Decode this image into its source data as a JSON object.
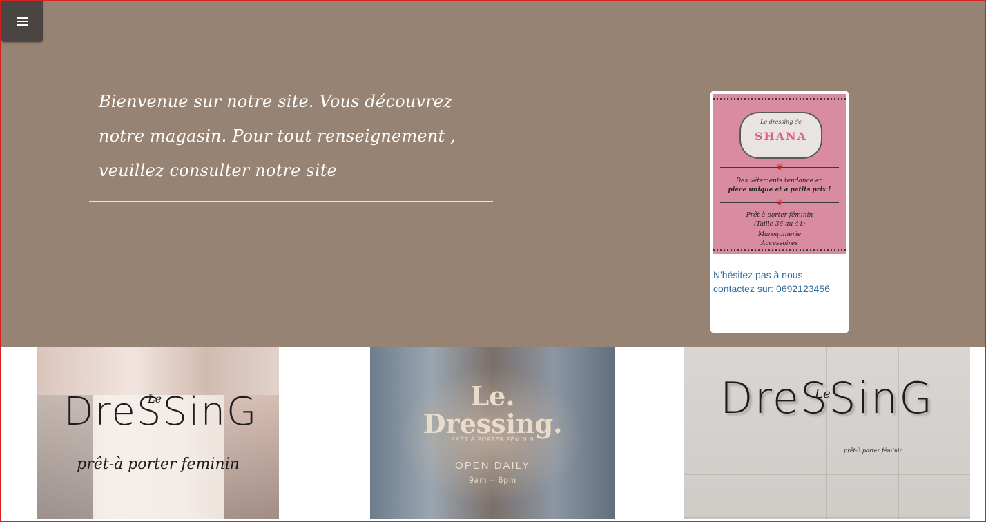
{
  "header": {
    "menu_icon": "hamburger-menu-icon"
  },
  "hero": {
    "welcome_text": "Bienvenue sur notre site. Vous découvrez notre magasin. Pour tout renseignement , veuillez consulter notre site"
  },
  "sidebar_card": {
    "poster": {
      "logo_small": "Le dressing de",
      "logo_big": "SHANA",
      "line1": "Des vêtements tendance en",
      "line2": "pièce unique et à petits prix !",
      "line3": "Prêt à porter féminin",
      "line4": "(Taille 36 au 44)",
      "line5": "Maroquinerie",
      "line6": "Accessoires"
    },
    "contact_text": "N'hésitez pas à nous contactez sur: 0692123456"
  },
  "gallery": {
    "image1": {
      "le": "Le",
      "logo": "DreSSinG",
      "tagline": "prêt-à porter feminin"
    },
    "image2": {
      "title_line1": "Le.",
      "title_line2": "Dressing.",
      "subtitle": "PRÊT À PORTER FÉMININ",
      "open": "OPEN DAILY",
      "hours": "9am – 6pm"
    },
    "image3": {
      "le": "Le",
      "logo": "DreSSinG",
      "tagline": "prêt-à porter féminin"
    }
  },
  "colors": {
    "hero_bg": "#978373",
    "menu_bg": "#4a4543",
    "link": "#2e6da4",
    "frame_border": "#d42020"
  }
}
